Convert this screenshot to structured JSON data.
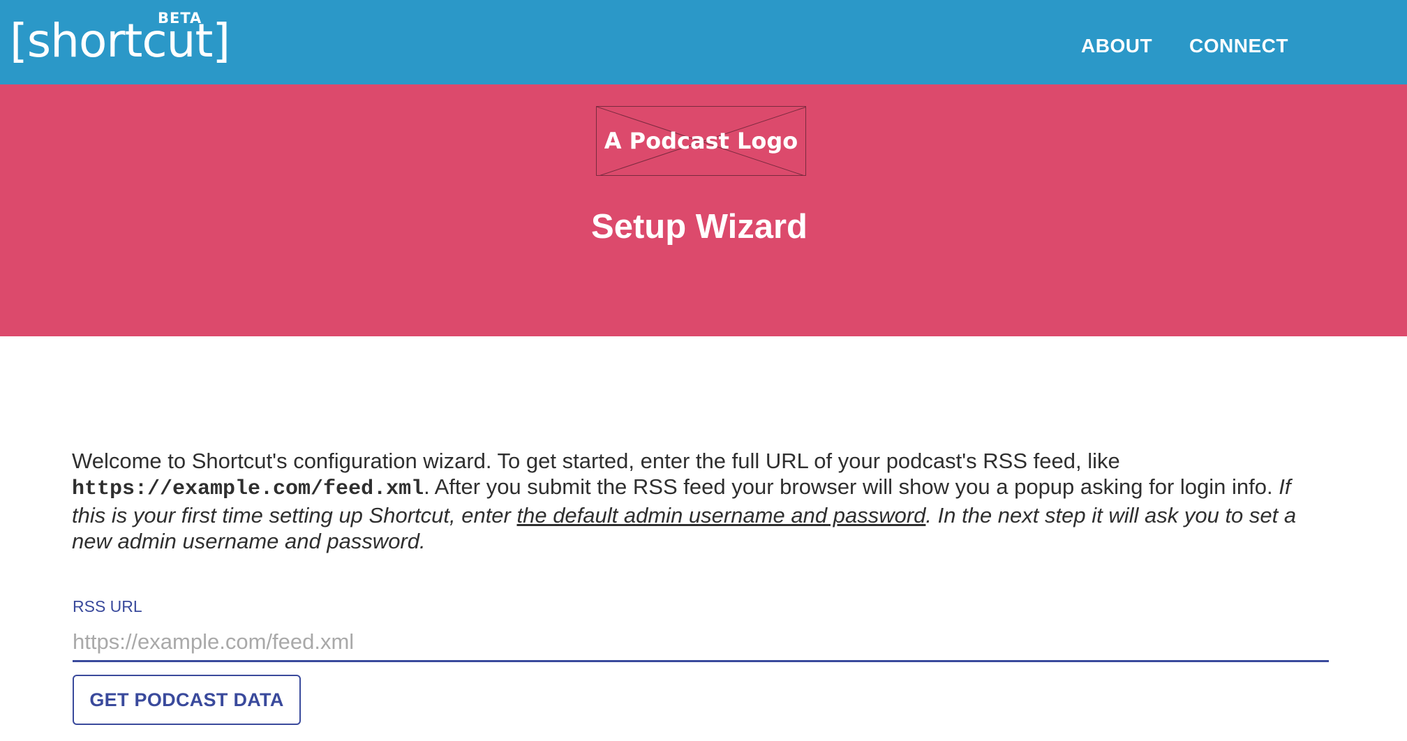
{
  "header": {
    "brand": "[shortcut]",
    "brand_badge": "BETA",
    "nav": [
      {
        "label": "ABOUT"
      },
      {
        "label": "CONNECT"
      }
    ]
  },
  "hero": {
    "logo_placeholder_text": "A Podcast Logo",
    "title": "Setup Wizard"
  },
  "main": {
    "intro": {
      "part1": "Welcome to Shortcut's configuration wizard. To get started, enter the full URL of your podcast's RSS feed, like ",
      "example_url": "https://example.com/feed.xml",
      "part2": ". After you submit the RSS feed your browser will show you a popup asking for login info. ",
      "italic_part1": "If this is your first time setting up Shortcut, enter ",
      "link_text": "the default admin username and password",
      "italic_part2": ". In the next step it will ask you to set a new admin username and password."
    },
    "rss_field": {
      "label": "RSS URL",
      "placeholder": "https://example.com/feed.xml",
      "value": ""
    },
    "submit_label": "GET PODCAST DATA"
  },
  "colors": {
    "header_bg": "#2b98c8",
    "hero_bg": "#dc4a6c",
    "accent": "#3a4a9c",
    "body_text": "#2f2f2f"
  }
}
